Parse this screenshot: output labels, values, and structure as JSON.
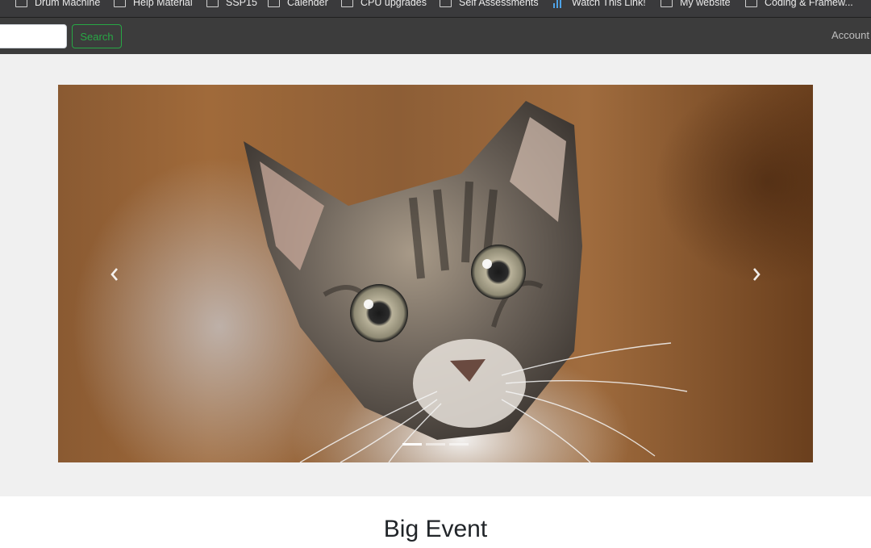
{
  "bookmarks": [
    {
      "label": "",
      "icon": "folder-icon"
    },
    {
      "label": "Drum Machine",
      "icon": "folder-icon"
    },
    {
      "label": "Help Material",
      "icon": "folder-icon"
    },
    {
      "label": "SSP15",
      "icon": "folder-icon"
    },
    {
      "label": "Calender",
      "icon": "folder-icon"
    },
    {
      "label": "CPU upgrades",
      "icon": "folder-icon"
    },
    {
      "label": "Self Assessments",
      "icon": "folder-icon"
    },
    {
      "label": "Watch This Link!",
      "icon": "link-icon"
    },
    {
      "label": "My website",
      "icon": "folder-icon"
    },
    {
      "label": "Coding & Framew...",
      "icon": "folder-icon"
    }
  ],
  "navbar": {
    "search_placeholder": "",
    "search_button": "Search",
    "account": "Account"
  },
  "carousel": {
    "slide_count": 3,
    "active_index": 0,
    "prev_glyph": "‹",
    "next_glyph": "›"
  },
  "content": {
    "title": "Big Event"
  },
  "colors": {
    "navbar_bg": "#3c3c3c",
    "search_button": "#28a745",
    "section_bg": "#f0f0f0"
  }
}
